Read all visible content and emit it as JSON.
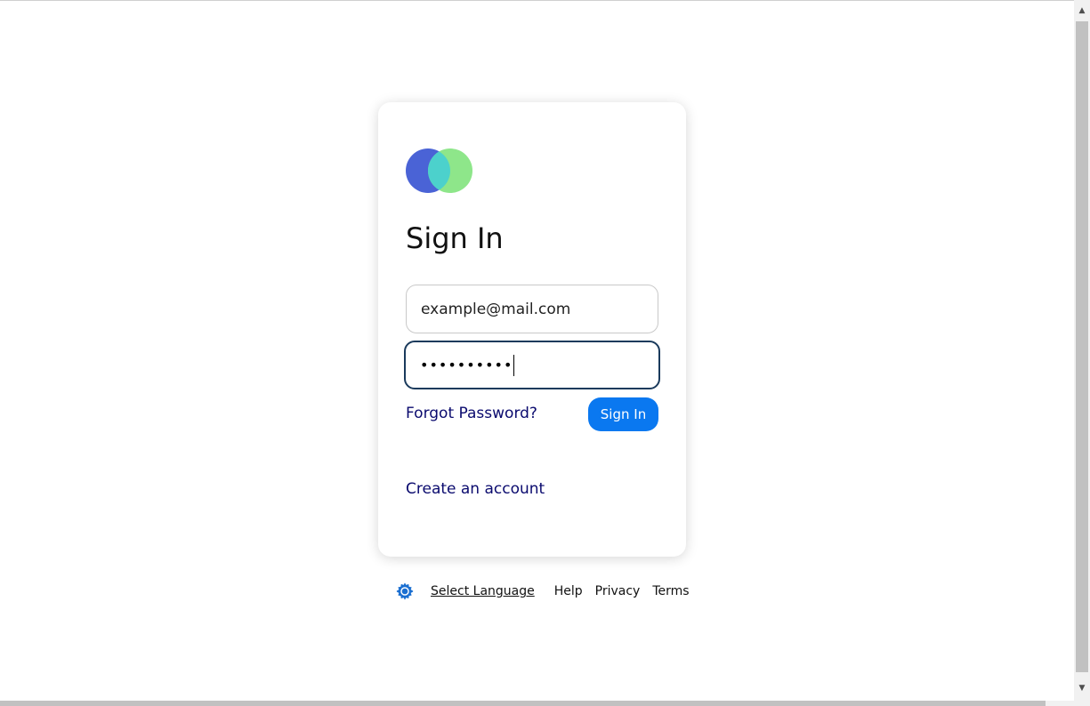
{
  "login": {
    "title": "Sign In",
    "email_value": "example@mail.com",
    "password_masked": "••••••••••",
    "forgot_link": "Forgot Password?",
    "signin_button": "Sign In",
    "create_account_link": "Create an account"
  },
  "footer": {
    "language_label": "Select Language",
    "links": [
      "Help",
      "Privacy",
      "Terms"
    ]
  },
  "colors": {
    "logo_left": "#4a63d6",
    "logo_right": "#8ee68a",
    "logo_overlap": "#4cd1cc",
    "primary_button": "#0a78f0",
    "link": "#0a0a6e",
    "gear": "#1b6fd1"
  },
  "icons": {
    "logo": "two-overlapping-circles",
    "language": "gear-icon"
  }
}
